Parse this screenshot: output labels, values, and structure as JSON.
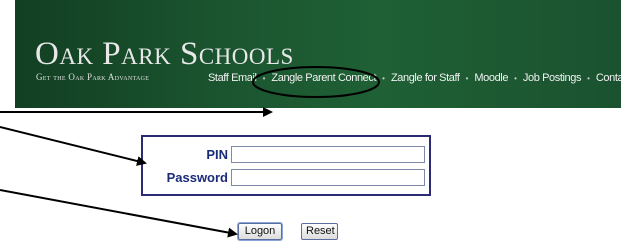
{
  "header": {
    "school_name": "Oak Park Schools",
    "tagline": "Get the Oak Park Advantage",
    "background_color": "#1b5530"
  },
  "nav": {
    "items": [
      {
        "label": "Staff Email"
      },
      {
        "label": "Zangle Parent Connect"
      },
      {
        "label": "Zangle for Staff"
      },
      {
        "label": "Moodle"
      },
      {
        "label": "Job Postings"
      },
      {
        "label": "Contact"
      }
    ],
    "separator": "•"
  },
  "login": {
    "pin_label": "PIN",
    "password_label": "Password",
    "pin_value": "",
    "password_value": "",
    "border_color": "#2b2a73",
    "label_color": "#1a2b7a"
  },
  "buttons": {
    "logon_label": "Logon",
    "reset_label": "Reset"
  },
  "annotations": {
    "highlighted_item": "Zangle Parent Connect",
    "arrow_count": 3,
    "arrow_color": "#000000"
  }
}
